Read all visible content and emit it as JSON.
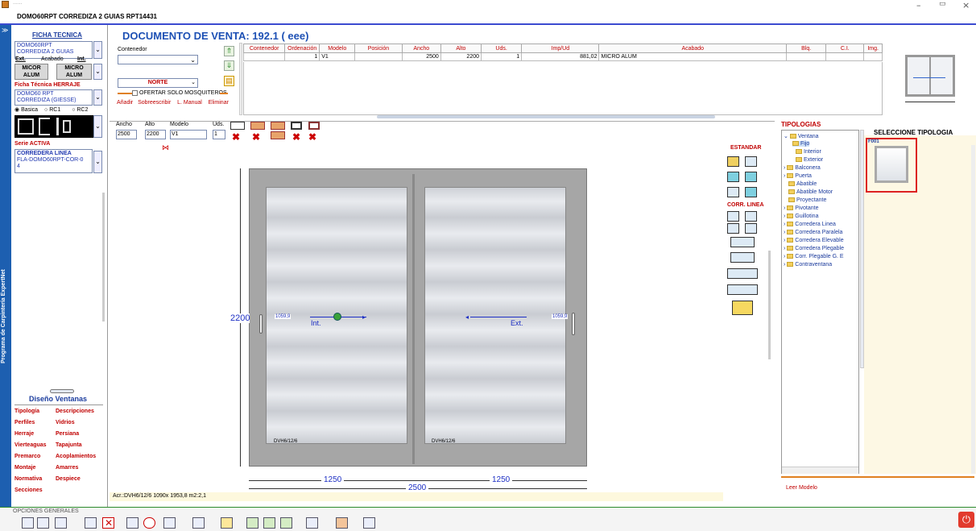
{
  "titlebar": {
    "title": "......",
    "min": "–",
    "max": "▭",
    "close": "×"
  },
  "header": {
    "title": "DOMO60RPT CORREDIZA 2 GUIAS RPT14431"
  },
  "vertical": {
    "title": "Programa de Carpintería ExpertNet"
  },
  "left": {
    "ficha_tecnica": "FICHA TECNICA",
    "product": [
      "DOMO60RPT",
      "CORREDIZA 2 GUIAS"
    ],
    "ext": "Ext.",
    "acabado": "Acabado",
    "int": "Int.",
    "col1": [
      "MICOR",
      "ALUM"
    ],
    "col2": [
      "MICRO",
      "ALUM"
    ],
    "herraje_title": "Ficha Técnica HERRAJE",
    "herraje": [
      "DOMO60 RPT",
      "CORREDIZA (GIESSE)"
    ],
    "radios": [
      "Basica",
      "RC1",
      "RC2"
    ],
    "serie_title": "Serie ACTIVA",
    "serie": [
      "CORREDERA LINEA",
      "FLA-DOMO60RPT-COR-0",
      "4"
    ],
    "diseno": "Diseño Ventanas",
    "links": [
      [
        "Tipología",
        "Descripciones"
      ],
      [
        "Perfiles",
        "Vidrios"
      ],
      [
        "Herraje",
        "Persiana"
      ],
      [
        "Vierteaguas",
        "Tapajunta"
      ],
      [
        "Premarco",
        "Acoplamientos"
      ],
      [
        "Montaje",
        "Amarres"
      ],
      [
        "Normativa",
        "Despiece"
      ],
      [
        "Secciones",
        ""
      ]
    ]
  },
  "doc": {
    "title": "DOCUMENTO DE VENTA: 192.1  ( eee)",
    "contenedor": "Contenedor",
    "norte": "NORTE",
    "mosquiteros": "OFERTAR SOLO MOSQUITEROS",
    "actions": [
      "Añadir",
      "Sobreescribir",
      "L. Manual",
      "Eliminar"
    ],
    "columns": [
      "Contenedor",
      "Ordenación",
      "Modelo",
      "Posición",
      "Ancho",
      "Alto",
      "Uds.",
      "Imp/Ud",
      "Acabado",
      "Blq.",
      "C.I.",
      "Img."
    ],
    "row": [
      "",
      "1",
      "V1",
      "",
      "2500",
      "2200",
      "1",
      "881,02",
      "MICRO ALUM",
      "",
      "",
      ""
    ]
  },
  "dims": {
    "ancho_l": "Ancho",
    "alto_l": "Alto",
    "modelo_l": "Modelo",
    "uds_l": "Uds.",
    "ancho": "2500",
    "alto": "2200",
    "modelo": "V1",
    "uds": "1"
  },
  "design": {
    "estandar": "ESTANDAR",
    "corr": "CORR. LINEA",
    "height": "2200",
    "w1": "1250",
    "w2": "1250",
    "total": "2500",
    "int": "Int.",
    "ext": "Ext.",
    "dim_left": "1059,9",
    "dim_right": "1059,9",
    "glass_l": "DVH6/12/6",
    "glass_r": "DVH6/12/6",
    "status": "Acr.:DVH6/12/6 1090x 1953,8 m2:2,1"
  },
  "right": {
    "tipologias": "TIPOLOGIAS",
    "seleccione": "SELECCIONE TIPOLOGIA",
    "f001": "F001",
    "leer": "Leer Modelo",
    "tree": [
      "Ventana",
      "Fijo",
      "Interior",
      "Exterior",
      "Balconera",
      "Puerta",
      "Abatible",
      "Abatible Motor",
      "Proyectante",
      "Pivotante",
      "Guillotina",
      "Corredera Linea",
      "Corredera Paralela",
      "Corredera Elevable",
      "Corredera Plegable",
      "Corr. Plegable G. E",
      "Contraventana"
    ]
  },
  "bottom": {
    "opciones": "OPCIONES GENERALES"
  }
}
